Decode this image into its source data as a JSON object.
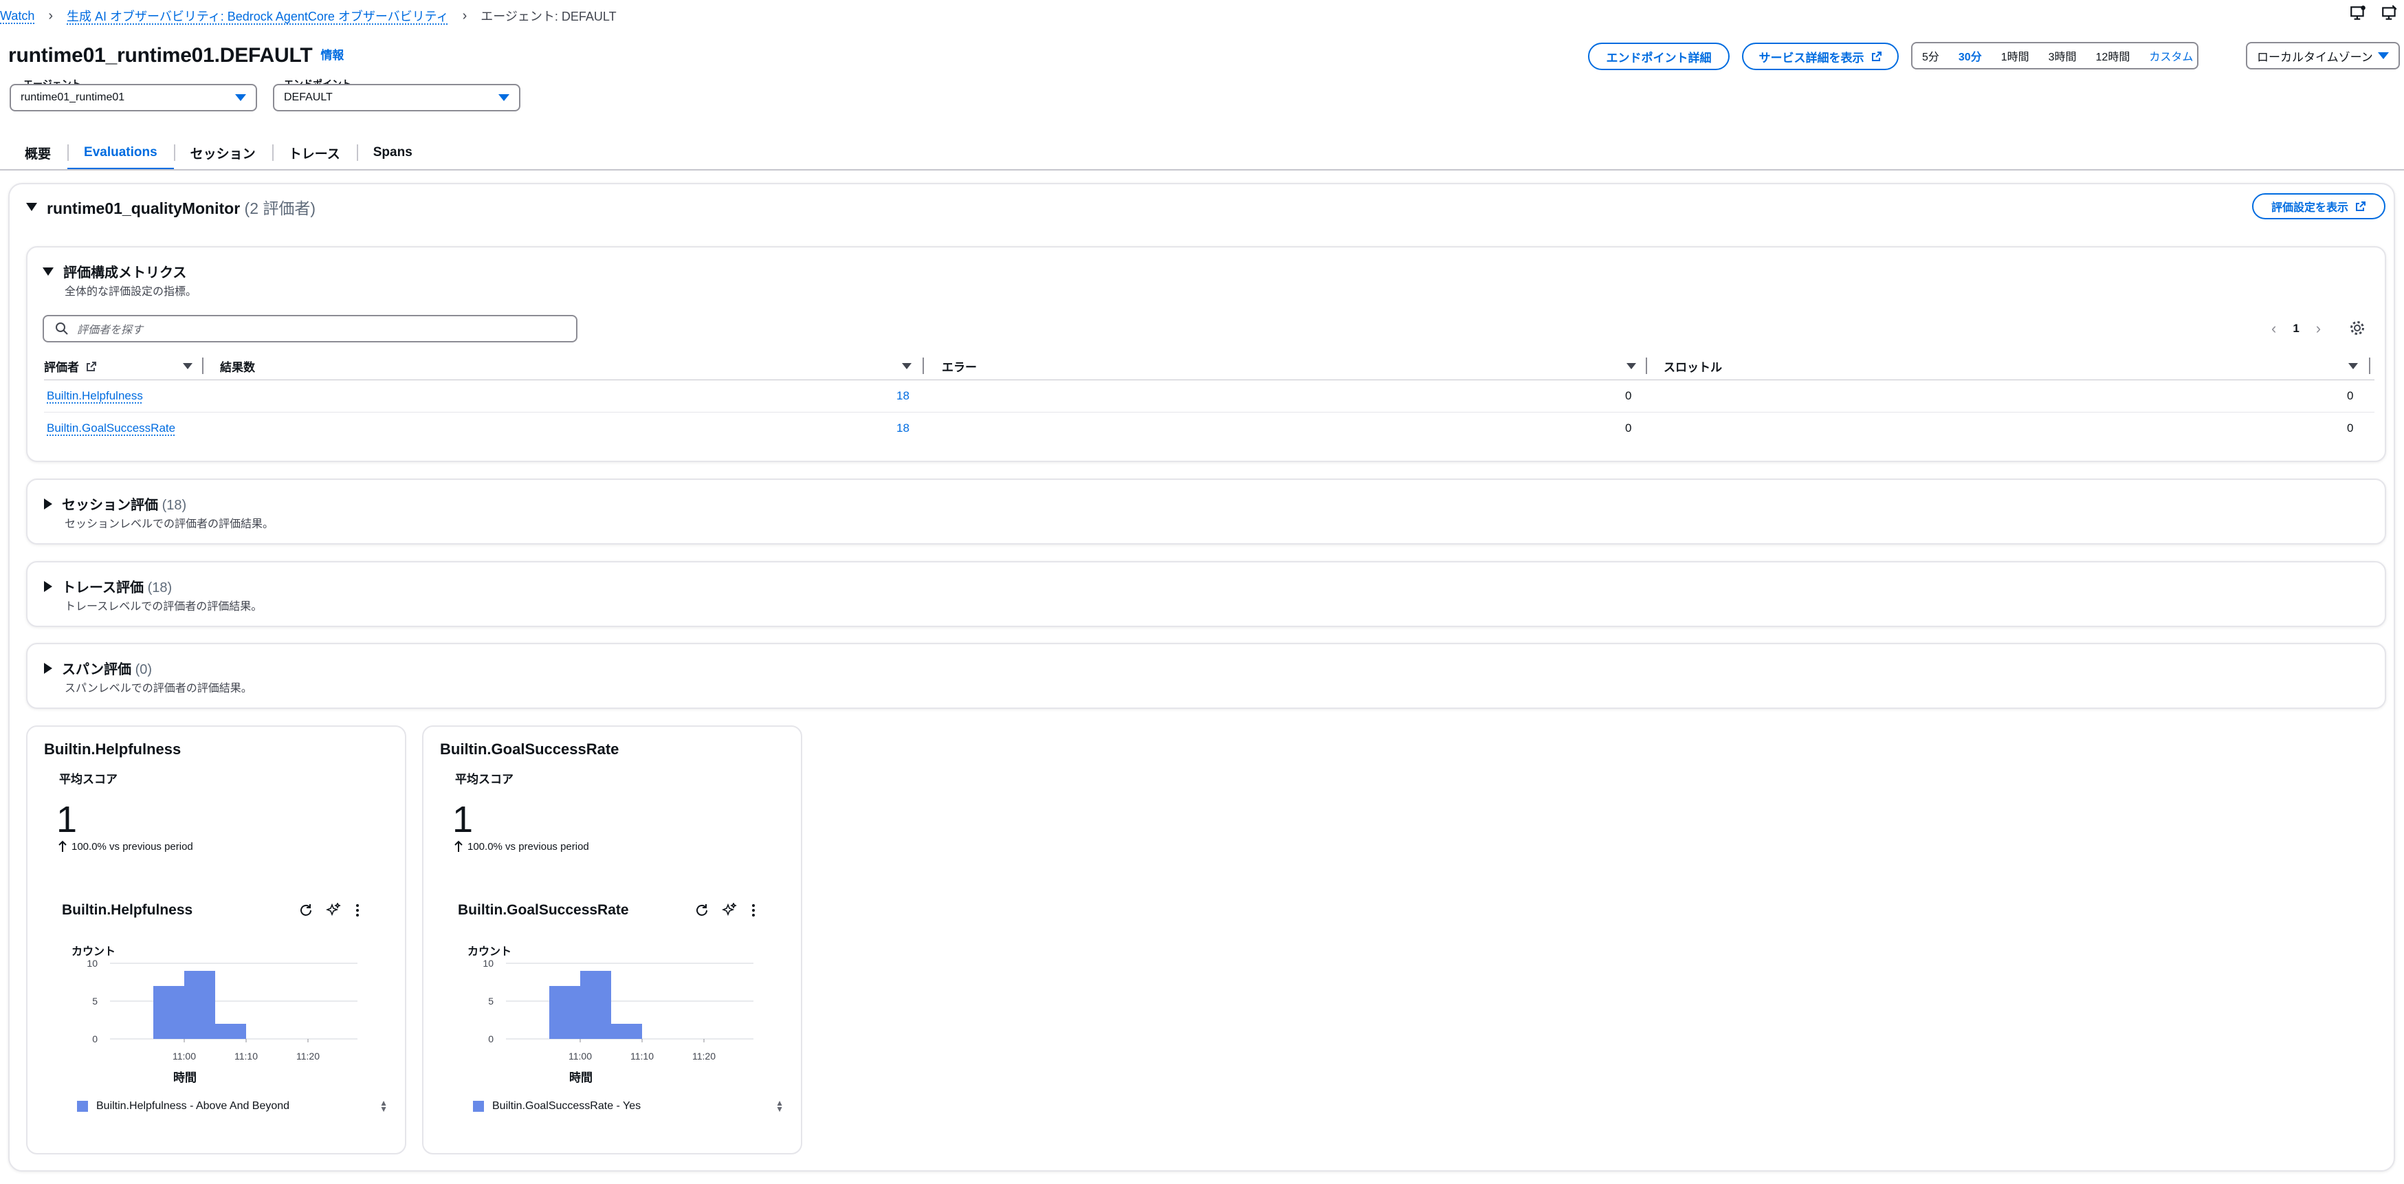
{
  "breadcrumb": {
    "items": [
      "Watch",
      "生成 AI オブザーバビリティ: Bedrock AgentCore オブザーバビリティ"
    ],
    "current": "エージェント: DEFAULT"
  },
  "header": {
    "title": "runtime01_runtime01.DEFAULT",
    "info": "情報",
    "agent_label": "エージェント",
    "agent_value": "runtime01_runtime01",
    "endpoint_label": "エンドポイント",
    "endpoint_value": "DEFAULT",
    "endpoint_details_button": "エンドポイント詳細",
    "service_details_button": "サービス詳細を表示",
    "time_ranges": [
      "5分",
      "30分",
      "1時間",
      "3時間",
      "12時間",
      "カスタム"
    ],
    "selected_time_range": "30分",
    "timezone": "ローカルタイムゾーン"
  },
  "tabs": [
    {
      "label": "概要",
      "active": false
    },
    {
      "label": "Evaluations",
      "active": true
    },
    {
      "label": "セッション",
      "active": false
    },
    {
      "label": "トレース",
      "active": false
    },
    {
      "label": "Spans",
      "active": false
    }
  ],
  "monitor": {
    "name": "runtime01_qualityMonitor",
    "count": "(2 評価者)",
    "view_config_button": "評価設定を表示"
  },
  "metrics_section": {
    "title": "評価構成メトリクス",
    "description": "全体的な評価設定の指標。",
    "search_placeholder": "評価者を探す",
    "page": "1",
    "columns": [
      "評価者",
      "結果数",
      "エラー",
      "スロットル"
    ],
    "rows": [
      {
        "evaluator": "Builtin.Helpfulness",
        "results": "18",
        "errors": "0",
        "throttles": "0"
      },
      {
        "evaluator": "Builtin.GoalSuccessRate",
        "results": "18",
        "errors": "0",
        "throttles": "0"
      }
    ]
  },
  "collapsed_sections": [
    {
      "title": "セッション評価",
      "count": "(18)",
      "description": "セッションレベルでの評価者の評価結果。"
    },
    {
      "title": "トレース評価",
      "count": "(18)",
      "description": "トレースレベルでの評価者の評価結果。"
    },
    {
      "title": "スパン評価",
      "count": "(0)",
      "description": "スパンレベルでの評価者の評価結果。"
    }
  ],
  "metric_cards": [
    {
      "title": "Builtin.Helpfulness",
      "avg_label": "平均スコア",
      "avg_value": "1",
      "trend": "100.0% vs previous period",
      "chart_title": "Builtin.Helpfulness",
      "ylabel": "カウント",
      "xlabel": "時間",
      "legend": "Builtin.Helpfulness - Above And Beyond"
    },
    {
      "title": "Builtin.GoalSuccessRate",
      "avg_label": "平均スコア",
      "avg_value": "1",
      "trend": "100.0% vs previous period",
      "chart_title": "Builtin.GoalSuccessRate",
      "ylabel": "カウント",
      "xlabel": "時間",
      "legend": "Builtin.GoalSuccessRate - Yes"
    }
  ],
  "colors": {
    "accent": "#006ce0",
    "bar": "#688ae8"
  },
  "chart_data": [
    {
      "type": "bar",
      "title": "Builtin.Helpfulness",
      "xlabel": "時間",
      "ylabel": "カウント",
      "ylim": [
        0,
        10
      ],
      "yticks": [
        "0",
        "5",
        "10"
      ],
      "xticks": [
        "11:00",
        "11:10",
        "11:20"
      ],
      "categories": [
        "10:55",
        "11:00",
        "11:05"
      ],
      "series": [
        {
          "name": "Builtin.Helpfulness - Above And Beyond",
          "values": [
            7,
            9,
            2
          ]
        }
      ]
    },
    {
      "type": "bar",
      "title": "Builtin.GoalSuccessRate",
      "xlabel": "時間",
      "ylabel": "カウント",
      "ylim": [
        0,
        10
      ],
      "yticks": [
        "0",
        "5",
        "10"
      ],
      "xticks": [
        "11:00",
        "11:10",
        "11:20"
      ],
      "categories": [
        "10:55",
        "11:00",
        "11:05"
      ],
      "series": [
        {
          "name": "Builtin.GoalSuccessRate - Yes",
          "values": [
            7,
            9,
            2
          ]
        }
      ]
    }
  ]
}
